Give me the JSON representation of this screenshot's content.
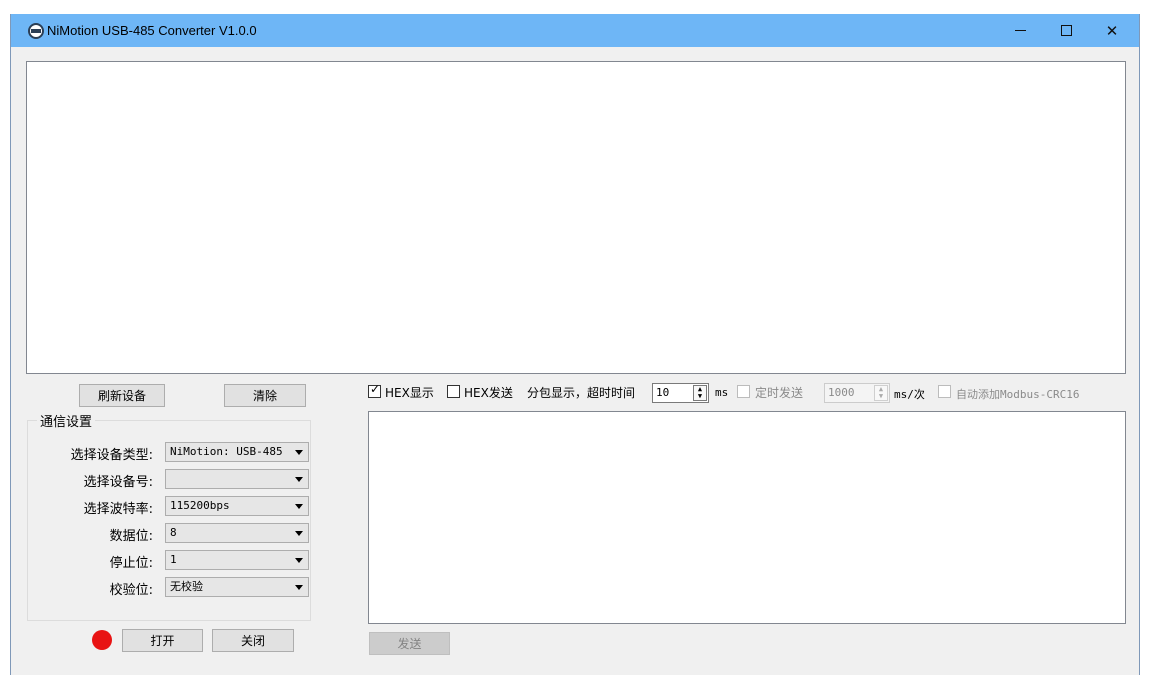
{
  "window": {
    "title": "NiMotion USB-485 Converter V1.0.0",
    "icon": "app-icon",
    "controls": {
      "minimize": "—",
      "maximize": "□",
      "close": "✕"
    }
  },
  "buttons": {
    "refresh": "刷新设备",
    "clear": "清除",
    "open": "打开",
    "close": "关闭",
    "send": "发送"
  },
  "comm_settings": {
    "title": "通信设置",
    "fields": [
      {
        "label": "选择设备类型:",
        "value": "NiMotion: USB-485"
      },
      {
        "label": "选择设备号:",
        "value": ""
      },
      {
        "label": "选择波特率:",
        "value": "115200bps"
      },
      {
        "label": "数据位:",
        "value": "8"
      },
      {
        "label": "停止位:",
        "value": "1"
      },
      {
        "label": "校验位:",
        "value": "无校验"
      }
    ]
  },
  "options": {
    "hex_display": {
      "label": "HEX显示",
      "checked": true
    },
    "hex_send": {
      "label": "HEX发送",
      "checked": false
    },
    "packet_label": "分包显示，超时时间",
    "timeout_value": "10",
    "timeout_unit": "ms",
    "timed_send": {
      "label": "定时发送",
      "checked": false
    },
    "interval_value": "1000",
    "interval_unit": "ms/次",
    "auto_crc": {
      "label": "自动添加Modbus-CRC16",
      "checked": false
    }
  },
  "status": {
    "color": "#e81313"
  }
}
